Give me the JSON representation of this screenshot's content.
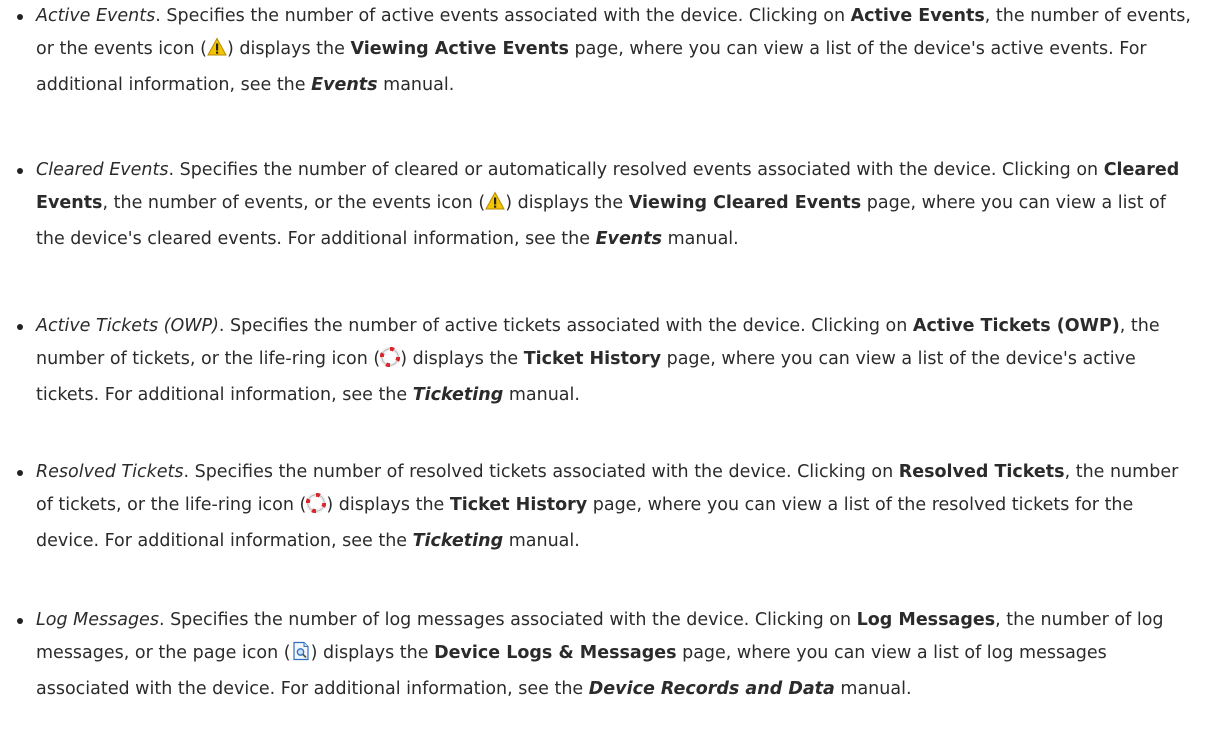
{
  "items": [
    {
      "segments": [
        {
          "s": "italic",
          "t": "Active Events"
        },
        {
          "s": "plain",
          "t": ". Specifies the number of active events associated with the device. Clicking on "
        },
        {
          "s": "bold",
          "t": "Active Events"
        },
        {
          "s": "plain",
          "t": ", the number of events, or the events icon ("
        },
        {
          "icon": "warning-icon"
        },
        {
          "s": "plain",
          "t": ") displays the "
        },
        {
          "s": "bold",
          "t": "Viewing Active Events"
        },
        {
          "s": "plain",
          "t": " page, where you can view a list of the device's active events. For additional information, see the "
        },
        {
          "s": "bolditalic",
          "t": "Events"
        },
        {
          "s": "plain",
          "t": " manual."
        }
      ]
    },
    {
      "segments": [
        {
          "s": "italic",
          "t": "Cleared Events"
        },
        {
          "s": "plain",
          "t": ". Specifies the number of cleared or automatically resolved events associated with the device. Clicking on "
        },
        {
          "s": "bold",
          "t": "Cleared Events"
        },
        {
          "s": "plain",
          "t": ", the number of events, or the events icon ("
        },
        {
          "icon": "warning-icon"
        },
        {
          "s": "plain",
          "t": ") displays the "
        },
        {
          "s": "bold",
          "t": "Viewing Cleared Events"
        },
        {
          "s": "plain",
          "t": " page, where you can view a list of the device's cleared events. For additional information, see the "
        },
        {
          "s": "bolditalic",
          "t": "Events"
        },
        {
          "s": "plain",
          "t": " manual."
        }
      ]
    },
    {
      "segments": [
        {
          "s": "italic",
          "t": "Active Tickets (OWP)"
        },
        {
          "s": "plain",
          "t": ". Specifies the number of active tickets associated with the device. Clicking on "
        },
        {
          "s": "bold",
          "t": "Active Tickets (OWP)"
        },
        {
          "s": "plain",
          "t": ", the number of tickets, or the life-ring icon ("
        },
        {
          "icon": "life-ring-icon"
        },
        {
          "s": "plain",
          "t": ") displays the "
        },
        {
          "s": "bold",
          "t": "Ticket History"
        },
        {
          "s": "plain",
          "t": " page, where you can view a list of the device's active tickets. For additional information, see the "
        },
        {
          "s": "bolditalic",
          "t": "Ticketing"
        },
        {
          "s": "plain",
          "t": " manual."
        }
      ]
    },
    {
      "segments": [
        {
          "s": "italic",
          "t": "Resolved Tickets"
        },
        {
          "s": "plain",
          "t": ". Specifies the number of resolved tickets associated with the device. Clicking on "
        },
        {
          "s": "bold",
          "t": "Resolved Tickets"
        },
        {
          "s": "plain",
          "t": ", the number of tickets, or the life-ring icon ("
        },
        {
          "icon": "life-ring-icon"
        },
        {
          "s": "plain",
          "t": ") displays the "
        },
        {
          "s": "bold",
          "t": "Ticket History"
        },
        {
          "s": "plain",
          "t": " page, where you can view a list of the resolved tickets for the device. For additional information, see the "
        },
        {
          "s": "bolditalic",
          "t": "Ticketing"
        },
        {
          "s": "plain",
          "t": " manual."
        }
      ]
    },
    {
      "segments": [
        {
          "s": "italic",
          "t": "Log Messages"
        },
        {
          "s": "plain",
          "t": ". Specifies the number of log messages associated with the device. Clicking on "
        },
        {
          "s": "bold",
          "t": "Log Messages"
        },
        {
          "s": "plain",
          "t": ", the number of log messages, or the page icon ("
        },
        {
          "icon": "page-icon"
        },
        {
          "s": "plain",
          "t": ") displays the "
        },
        {
          "s": "bold",
          "t": "Device Logs & Messages"
        },
        {
          "s": "plain",
          "t": " page, where you can view a list of log messages associated with the device. For additional information, see the "
        },
        {
          "s": "bolditalic",
          "t": "Device Records and Data"
        },
        {
          "s": "plain",
          "t": " manual."
        }
      ]
    }
  ],
  "colors": {
    "text": "#2b2b2b",
    "warning_fill": "#f5c400",
    "lifering_red": "#d9262c",
    "page_blue": "#2f6fc0"
  }
}
